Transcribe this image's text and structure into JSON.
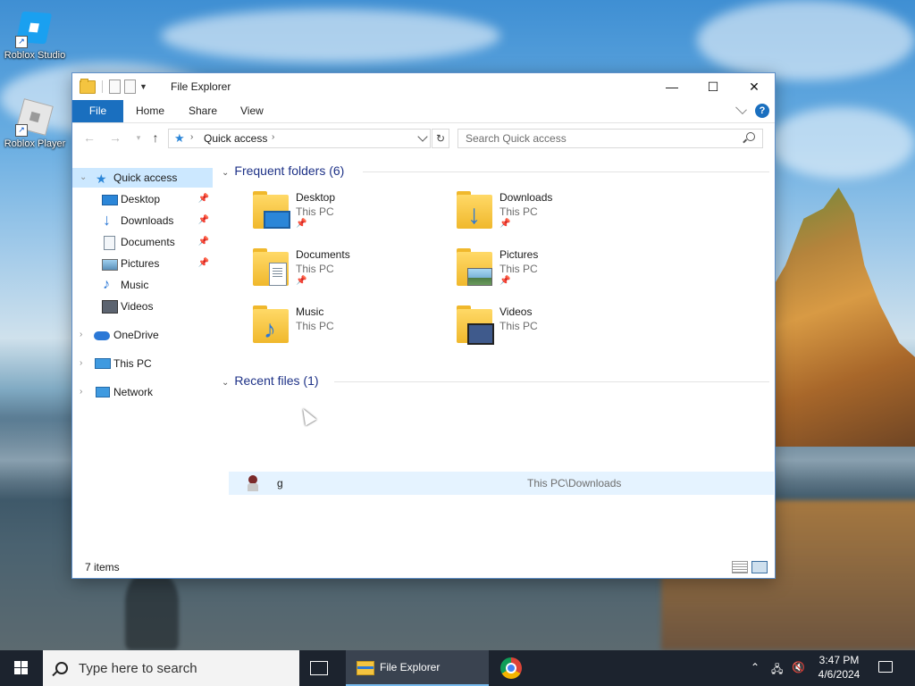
{
  "desktop": {
    "icons": [
      {
        "label": "Roblox Studio",
        "icon": "roblox-studio-icon"
      },
      {
        "label": "Roblox Player",
        "icon": "roblox-player-icon"
      }
    ]
  },
  "window": {
    "title": "File Explorer",
    "controls": {
      "minimize": "—",
      "maximize": "☐",
      "close": "✕"
    },
    "ribbon_tabs": [
      "File",
      "Home",
      "Share",
      "View"
    ],
    "help": "?",
    "address": {
      "path": "Quick access",
      "refresh": "↻"
    },
    "search": {
      "placeholder": "Search Quick access"
    },
    "nav": {
      "back": "←",
      "forward": "→",
      "up": "↑"
    },
    "navpane": {
      "quick_access": "Quick access",
      "items": [
        {
          "label": "Desktop",
          "icon": "desktop-icon",
          "pinned": true
        },
        {
          "label": "Downloads",
          "icon": "downloads-icon",
          "pinned": true
        },
        {
          "label": "Documents",
          "icon": "documents-icon",
          "pinned": true
        },
        {
          "label": "Pictures",
          "icon": "pictures-icon",
          "pinned": true
        },
        {
          "label": "Music",
          "icon": "music-icon",
          "pinned": false
        },
        {
          "label": "Videos",
          "icon": "videos-icon",
          "pinned": false
        }
      ],
      "onedrive": "OneDrive",
      "this_pc": "This PC",
      "network": "Network"
    },
    "frequent": {
      "header": "Frequent folders (6)",
      "folders": [
        {
          "name": "Desktop",
          "location": "This PC",
          "pinned": true
        },
        {
          "name": "Downloads",
          "location": "This PC",
          "pinned": true
        },
        {
          "name": "Documents",
          "location": "This PC",
          "pinned": true
        },
        {
          "name": "Pictures",
          "location": "This PC",
          "pinned": true
        },
        {
          "name": "Music",
          "location": "This PC",
          "pinned": false
        },
        {
          "name": "Videos",
          "location": "This PC",
          "pinned": false
        }
      ]
    },
    "recent": {
      "header": "Recent files (1)",
      "files": [
        {
          "name": "g",
          "path": "This PC\\Downloads"
        }
      ]
    },
    "status": "7 items",
    "accent": "#1a6fbf"
  },
  "taskbar": {
    "search_placeholder": "Type here to search",
    "apps": [
      {
        "label": "File Explorer",
        "icon": "file-explorer-icon",
        "active": true
      },
      {
        "label": "",
        "icon": "chrome-icon",
        "active": false
      }
    ],
    "time": "3:47 PM",
    "date": "4/6/2024"
  }
}
